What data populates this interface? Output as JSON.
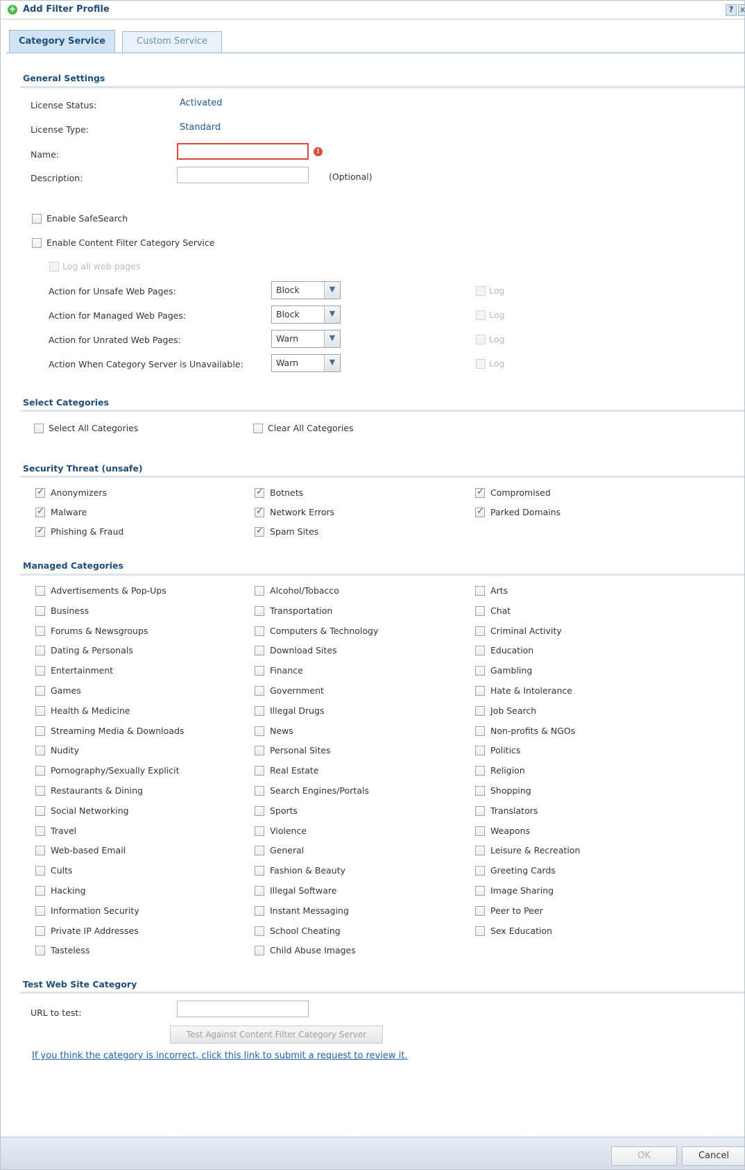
{
  "window": {
    "title": "Add Filter Profile",
    "help": "?",
    "close": "x"
  },
  "tabs": [
    {
      "label": "Category Service",
      "active": true
    },
    {
      "label": "Custom Service",
      "active": false
    }
  ],
  "general": {
    "section_title": "General Settings",
    "license_status_label": "License Status:",
    "license_status_value": "Activated",
    "license_type_label": "License Type:",
    "license_type_value": "Standard",
    "name_label": "Name:",
    "name_value": "",
    "description_label": "Description:",
    "description_value": "",
    "optional_text": "(Optional)",
    "enable_safesearch": "Enable SafeSearch",
    "enable_cf": "Enable Content Filter Category Service",
    "log_all": "Log all web pages",
    "actions": [
      {
        "label": "Action for Unsafe Web Pages:",
        "value": "Block",
        "log": "Log"
      },
      {
        "label": "Action for Managed Web Pages:",
        "value": "Block",
        "log": "Log"
      },
      {
        "label": "Action for Unrated Web Pages:",
        "value": "Warn",
        "log": "Log"
      },
      {
        "label": "Action When Category Server is Unavailable:",
        "value": "Warn",
        "log": "Log"
      }
    ]
  },
  "select": {
    "section_title": "Select Categories",
    "select_all": "Select All Categories",
    "clear_all": "Clear All Categories"
  },
  "threat": {
    "section_title": "Security Threat (unsafe)",
    "items": [
      "Anonymizers",
      "Botnets",
      "Compromised",
      "Malware",
      "Network Errors",
      "Parked Domains",
      "Phishing & Fraud",
      "Spam Sites"
    ]
  },
  "managed": {
    "section_title": "Managed Categories",
    "items": [
      "Advertisements & Pop-Ups",
      "Alcohol/Tobacco",
      "Arts",
      "Business",
      "Transportation",
      "Chat",
      "Forums & Newsgroups",
      "Computers & Technology",
      "Criminal Activity",
      "Dating & Personals",
      "Download Sites",
      "Education",
      "Entertainment",
      "Finance",
      "Gambling",
      "Games",
      "Government",
      "Hate & Intolerance",
      "Health & Medicine",
      "Illegal Drugs",
      "Job Search",
      "Streaming Media & Downloads",
      "News",
      "Non-profits & NGOs",
      "Nudity",
      "Personal Sites",
      "Politics",
      "Pornography/Sexually Explicit",
      "Real Estate",
      "Religion",
      "Restaurants & Dining",
      "Search Engines/Portals",
      "Shopping",
      "Social Networking",
      "Sports",
      "Translators",
      "Travel",
      "Violence",
      "Weapons",
      "Web-based Email",
      "General",
      "Leisure & Recreation",
      "Cults",
      "Fashion & Beauty",
      "Greeting Cards",
      "Hacking",
      "Illegal Software",
      "Image Sharing",
      "Information Security",
      "Instant Messaging",
      "Peer to Peer",
      "Private IP Addresses",
      "School Cheating",
      "Sex Education",
      "Tasteless",
      "Child Abuse Images"
    ]
  },
  "test": {
    "section_title": "Test Web Site Category",
    "url_label": "URL to test:",
    "url_value": "",
    "test_button": "Test Against Content Filter Category Server",
    "review_link": "If you think the category is incorrect, click this link to submit a request to review it."
  },
  "footer": {
    "ok": "OK",
    "cancel": "Cancel"
  }
}
